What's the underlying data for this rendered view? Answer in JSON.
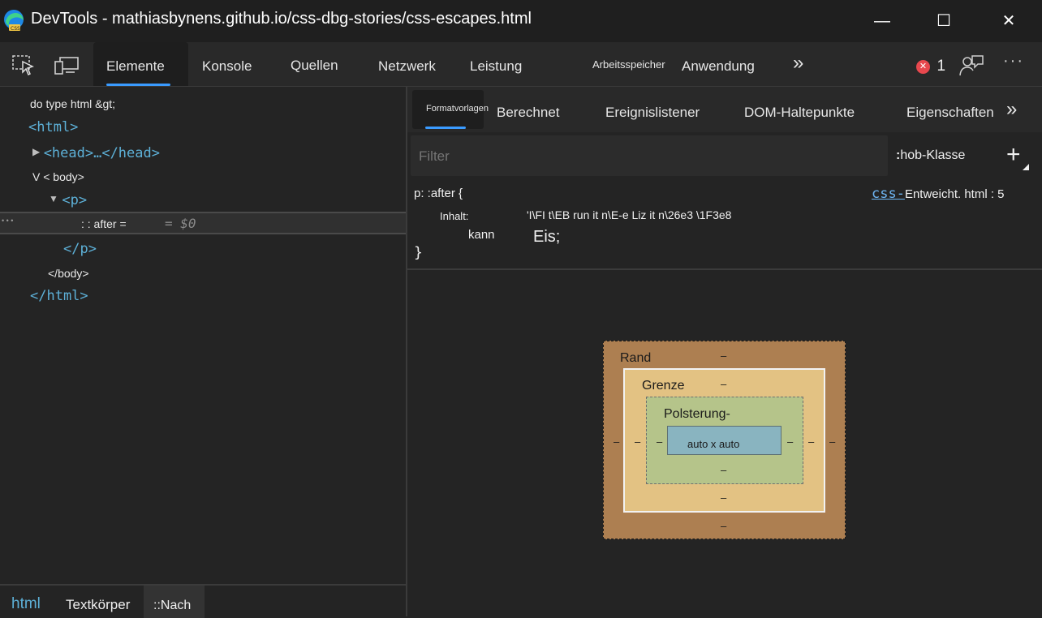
{
  "window": {
    "title": "DevTools - mathiasbynens.github.io/css-dbg-stories/css-escapes.html",
    "controls": {
      "minimize": "—",
      "maximize": "☐",
      "close": "✕"
    }
  },
  "toolbar": {
    "icons": [
      "inspect-icon",
      "device-emulation-icon"
    ],
    "tabs": [
      "Elemente",
      "Konsole",
      "Quellen",
      "Netzwerk",
      "Leistung",
      "Arbeitsspeicher",
      "Anwendung"
    ],
    "active_tab": "Elemente",
    "more": "»",
    "error_count": "1",
    "error_icon": "✕",
    "feedback_icon": "feedback-icon",
    "menu": "···"
  },
  "dom": {
    "lines": [
      "do type html &gt;",
      "<html>",
      "<head>…</head>",
      "V < body>",
      "<p>",
      ": : after =",
      "= $0",
      "</p>",
      "</body>",
      "</html>"
    ],
    "row_dots": "• • •"
  },
  "breadcrumb": {
    "items": [
      "html",
      "Textkörper",
      "::Nach"
    ]
  },
  "styles": {
    "tabs": [
      "Formatvorlagen",
      "Berechnet",
      "Ereignislistener",
      "DOM-Haltepunkte",
      "Eigenschaften"
    ],
    "more": "»",
    "filter_placeholder": "Filter",
    "hov_cls": "hob-Klasse",
    "hov_prefix": ":",
    "add": "+",
    "rule": {
      "selector": "p: :after {",
      "source_link": "css-",
      "source_rest": "Entweicht. html : 5",
      "prop1_name": "Inhalt:",
      "prop1_value": "'I\\FI t\\EB run it n\\E-e Liz it n\\26e3 \\1F3e8",
      "prop2_name": "kann",
      "prop2_value": "Eis;",
      "close": "}"
    }
  },
  "box_model": {
    "margin_label": "Rand",
    "border_label": "Grenze",
    "padding_label": "Polsterung-",
    "content": "auto x auto",
    "dash": "–"
  },
  "colors": {
    "accent": "#3a9bff",
    "tag": "#5db0d7",
    "error": "#e8484e",
    "margin": "#ad7f51",
    "border": "#e3c283",
    "padding": "#b5c48a",
    "content": "#89b4c0"
  }
}
